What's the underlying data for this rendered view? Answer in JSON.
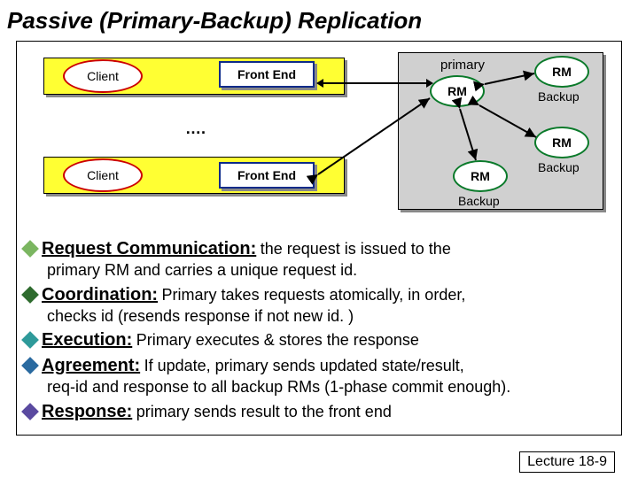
{
  "title": "Passive (Primary-Backup) Replication",
  "diagram": {
    "client": "Client",
    "frontend": "Front End",
    "dots": "….",
    "primary": "primary",
    "rm": "RM",
    "backup": "Backup"
  },
  "bullets": [
    {
      "title": "Request Communication:",
      "text": "the request is issued to the",
      "sub": "primary RM and carries a unique request id."
    },
    {
      "title": "Coordination:",
      "text": "Primary takes requests atomically, in order,",
      "sub": "checks id (resends response if not new id. )"
    },
    {
      "title": "Execution:",
      "text": "Primary executes & stores the response",
      "sub": ""
    },
    {
      "title": "Agreement:",
      "text": "If update, primary sends updated state/result,",
      "sub": "req-id and response to all backup RMs (1-phase commit enough)."
    },
    {
      "title": "Response:",
      "text": "primary sends result to the front end",
      "sub": ""
    }
  ],
  "lecture": "Lecture 18-9"
}
